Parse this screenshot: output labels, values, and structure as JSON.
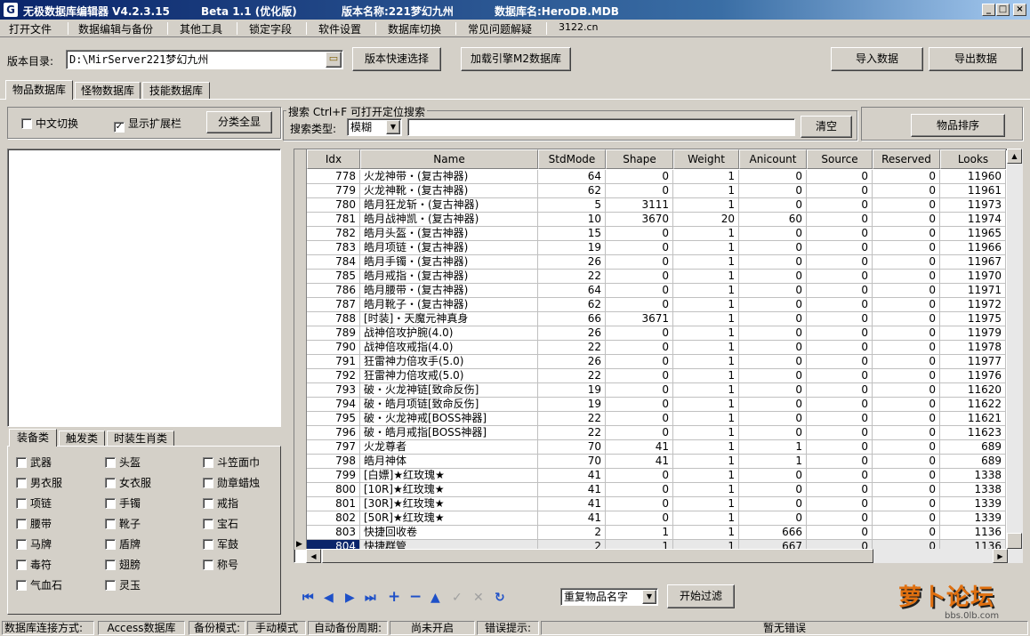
{
  "window": {
    "title": "无极数据库编辑器 V4.2.3.15",
    "beta": "Beta 1.1 (优化版)",
    "version_name": "版本名称:221梦幻九州",
    "db_name": "数据库名:HeroDB.MDB",
    "icon_label": "G",
    "min": "_",
    "max": "□",
    "close": "×"
  },
  "menu": [
    "打开文件",
    "数据编辑与备份",
    "其他工具",
    "锁定字段",
    "软件设置",
    "数据库切换",
    "常见问题解疑",
    "3122.cn"
  ],
  "toolbar": {
    "dir_label": "版本目录:",
    "dir_value": "D:\\MirServer221梦幻九州",
    "quick_select": "版本快速选择",
    "load_m2": "加载引擎M2数据库",
    "import": "导入数据",
    "export": "导出数据"
  },
  "tabs": [
    "物品数据库",
    "怪物数据库",
    "技能数据库"
  ],
  "left": {
    "chinese_toggle": "中文切换",
    "show_ext": "显示扩展栏",
    "category_all": "分类全显",
    "chk_mark": "✓"
  },
  "search": {
    "group_label": "搜索 Ctrl+F 可打开定位搜索",
    "type_label": "搜索类型:",
    "type_value": "模糊",
    "clear": "清空",
    "sort": "物品排序"
  },
  "cat_tabs": [
    "装备类",
    "触发类",
    "时装生肖类"
  ],
  "categories": [
    [
      "武器",
      "头盔",
      "斗笠面巾"
    ],
    [
      "男衣服",
      "女衣服",
      "勋章蜡烛"
    ],
    [
      "项链",
      "手镯",
      "戒指"
    ],
    [
      "腰带",
      "靴子",
      "宝石"
    ],
    [
      "马牌",
      "盾牌",
      "军鼓"
    ],
    [
      "毒符",
      "翅膀",
      "称号"
    ],
    [
      "气血石",
      "灵玉",
      ""
    ]
  ],
  "columns": [
    "Idx",
    "Name",
    "StdMode",
    "Shape",
    "Weight",
    "Anicount",
    "Source",
    "Reserved",
    "Looks"
  ],
  "rows": [
    [
      "778",
      "火龙神带・(复古神器)",
      "64",
      "0",
      "1",
      "0",
      "0",
      "0",
      "11960"
    ],
    [
      "779",
      "火龙神靴・(复古神器)",
      "62",
      "0",
      "1",
      "0",
      "0",
      "0",
      "11961"
    ],
    [
      "780",
      "皓月狂龙斩・(复古神器)",
      "5",
      "3111",
      "1",
      "0",
      "0",
      "0",
      "11973"
    ],
    [
      "781",
      "皓月战神凯・(复古神器)",
      "10",
      "3670",
      "20",
      "60",
      "0",
      "0",
      "11974"
    ],
    [
      "782",
      "皓月头盔・(复古神器)",
      "15",
      "0",
      "1",
      "0",
      "0",
      "0",
      "11965"
    ],
    [
      "783",
      "皓月项链・(复古神器)",
      "19",
      "0",
      "1",
      "0",
      "0",
      "0",
      "11966"
    ],
    [
      "784",
      "皓月手镯・(复古神器)",
      "26",
      "0",
      "1",
      "0",
      "0",
      "0",
      "11967"
    ],
    [
      "785",
      "皓月戒指・(复古神器)",
      "22",
      "0",
      "1",
      "0",
      "0",
      "0",
      "11970"
    ],
    [
      "786",
      "皓月腰带・(复古神器)",
      "64",
      "0",
      "1",
      "0",
      "0",
      "0",
      "11971"
    ],
    [
      "787",
      "皓月靴子・(复古神器)",
      "62",
      "0",
      "1",
      "0",
      "0",
      "0",
      "11972"
    ],
    [
      "788",
      "[时装]・天魔元神真身",
      "66",
      "3671",
      "1",
      "0",
      "0",
      "0",
      "11975"
    ],
    [
      "789",
      "战神倍攻护腕(4.0)",
      "26",
      "0",
      "1",
      "0",
      "0",
      "0",
      "11979"
    ],
    [
      "790",
      "战神倍攻戒指(4.0)",
      "22",
      "0",
      "1",
      "0",
      "0",
      "0",
      "11978"
    ],
    [
      "791",
      "狂雷神力倍攻手(5.0)",
      "26",
      "0",
      "1",
      "0",
      "0",
      "0",
      "11977"
    ],
    [
      "792",
      "狂雷神力倍攻戒(5.0)",
      "22",
      "0",
      "1",
      "0",
      "0",
      "0",
      "11976"
    ],
    [
      "793",
      "破・火龙神链[致命反伤]",
      "19",
      "0",
      "1",
      "0",
      "0",
      "0",
      "11620"
    ],
    [
      "794",
      "破・皓月项链[致命反伤]",
      "19",
      "0",
      "1",
      "0",
      "0",
      "0",
      "11622"
    ],
    [
      "795",
      "破・火龙神戒[BOSS神器]",
      "22",
      "0",
      "1",
      "0",
      "0",
      "0",
      "11621"
    ],
    [
      "796",
      "破・皓月戒指[BOSS神器]",
      "22",
      "0",
      "1",
      "0",
      "0",
      "0",
      "11623"
    ],
    [
      "797",
      "火龙尊者",
      "70",
      "41",
      "1",
      "1",
      "0",
      "0",
      "689"
    ],
    [
      "798",
      "皓月神体",
      "70",
      "41",
      "1",
      "1",
      "0",
      "0",
      "689"
    ],
    [
      "799",
      "[白嫖]★红玫瑰★",
      "41",
      "0",
      "1",
      "0",
      "0",
      "0",
      "1338"
    ],
    [
      "800",
      "[10R]★红玫瑰★",
      "41",
      "0",
      "1",
      "0",
      "0",
      "0",
      "1338"
    ],
    [
      "801",
      "[30R]★红玫瑰★",
      "41",
      "0",
      "1",
      "0",
      "0",
      "0",
      "1339"
    ],
    [
      "802",
      "[50R]★红玫瑰★",
      "41",
      "0",
      "1",
      "0",
      "0",
      "0",
      "1339"
    ],
    [
      "803",
      "快捷回收卷",
      "2",
      "1",
      "1",
      "666",
      "0",
      "0",
      "1136"
    ],
    [
      "804",
      "快捷群管",
      "2",
      "1",
      "1",
      "667",
      "0",
      "0",
      "1136"
    ]
  ],
  "nav": {
    "dup_value": "重复物品名字",
    "start_filter": "开始过滤",
    "icons": [
      "⏮",
      "◀",
      "▶",
      "⏭",
      "+",
      "−",
      "▲",
      "✓",
      "✕",
      "↻"
    ],
    "row_pointer": "▶",
    "scroll_up": "▲",
    "scroll_left": "◀",
    "scroll_right": "▶",
    "dropdown_arrow": "▼",
    "folder": "▭"
  },
  "status": {
    "conn_label": "数据库连接方式:",
    "conn_value": "Access数据库",
    "backup_label": "备份模式:",
    "backup_value": "手动模式",
    "auto_label": "自动备份周期:",
    "auto_value": "尚未开启",
    "err_label": "错误提示:",
    "err_value": "暂无错误"
  },
  "watermark": "bbs.0lb.com",
  "watermark_logo": "萝卜论坛"
}
